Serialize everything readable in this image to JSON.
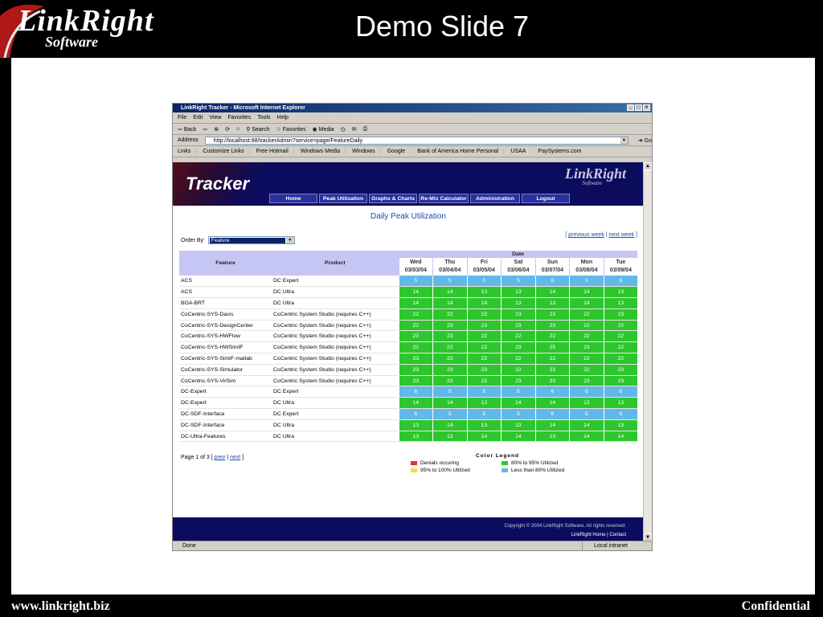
{
  "slide": {
    "logo_line1": "LinkRight",
    "logo_line2": "Software",
    "title": "Demo Slide 7",
    "footer_left": "www.linkright.biz",
    "footer_right": "Confidential"
  },
  "browser": {
    "window_title": "LinkRight Tracker - Microsoft Internet Explorer",
    "menu": [
      "File",
      "Edit",
      "View",
      "Favorites",
      "Tools",
      "Help"
    ],
    "toolbar": [
      "Back",
      "Search",
      "Favorites",
      "Media"
    ],
    "address_label": "Address",
    "address": "http://localhost:88/trackerAdmin?service=page/FeatureDaily",
    "go_label": "Go",
    "links_label": "Links",
    "links": [
      "Customize Links",
      "Free Hotmail",
      "Windows Media",
      "Windows",
      "Google",
      "Bank of America Home Personal",
      "USAA",
      "PaySystems.com"
    ],
    "status": "Done",
    "zone": "Local intranet"
  },
  "app": {
    "banner_title": "Tracker",
    "banner_logo": "LinkRight",
    "banner_logo_sub": "Software",
    "nav": [
      {
        "label": "Home"
      },
      {
        "label": "Peak Utilization"
      },
      {
        "label": "Graphs & Charts"
      },
      {
        "label": "Re-Mix Calculator"
      },
      {
        "label": "Administration"
      },
      {
        "label": "Logout"
      }
    ],
    "page_title": "Daily Peak Utilization",
    "order_by_label": "Order By:",
    "order_by_value": "Feature",
    "week_prev": "previous week",
    "week_next": "next week",
    "col_feature": "Feature",
    "col_product": "Product",
    "col_date": "Date",
    "days": [
      {
        "d": "Wed",
        "date": "03/03/04"
      },
      {
        "d": "Thu",
        "date": "03/04/04"
      },
      {
        "d": "Fri",
        "date": "03/05/04"
      },
      {
        "d": "Sat",
        "date": "03/06/04"
      },
      {
        "d": "Sun",
        "date": "03/07/04"
      },
      {
        "d": "Mon",
        "date": "03/08/04"
      },
      {
        "d": "Tue",
        "date": "03/09/04"
      }
    ],
    "rows": [
      {
        "feature": "ACS",
        "product": "DC Expert",
        "values": [
          5,
          5,
          5,
          5,
          6,
          5,
          6
        ],
        "status": "less-than-80"
      },
      {
        "feature": "ACS",
        "product": "DC Ultra",
        "values": [
          14,
          14,
          13,
          13,
          14,
          14,
          13
        ],
        "status": "80-to-95"
      },
      {
        "feature": "BOA-BRT",
        "product": "DC Ultra",
        "values": [
          14,
          14,
          14,
          13,
          13,
          14,
          13
        ],
        "status": "80-to-95"
      },
      {
        "feature": "CoCentric-SYS-Davis",
        "product": "CoCentric System Studio (requires C++)",
        "values": [
          22,
          22,
          22,
          23,
          23,
          22,
          23
        ],
        "status": "80-to-95"
      },
      {
        "feature": "CoCentric-SYS-DesignCenter",
        "product": "CoCentric System Studio (requires C++)",
        "values": [
          22,
          23,
          23,
          23,
          23,
          22,
          22
        ],
        "status": "80-to-95"
      },
      {
        "feature": "CoCentric-SYS-HWFlow",
        "product": "CoCentric System Studio (requires C++)",
        "values": [
          23,
          23,
          22,
          22,
          22,
          22,
          22
        ],
        "status": "80-to-95"
      },
      {
        "feature": "CoCentric-SYS-HWSimIF",
        "product": "CoCentric System Studio (requires C++)",
        "values": [
          22,
          22,
          22,
          23,
          25,
          23,
          22
        ],
        "status": "80-to-95"
      },
      {
        "feature": "CoCentric-SYS-SimIF-matlab",
        "product": "CoCentric System Studio (requires C++)",
        "values": [
          23,
          22,
          22,
          22,
          22,
          22,
          22
        ],
        "status": "80-to-95"
      },
      {
        "feature": "CoCentric-SYS-Simulator",
        "product": "CoCentric System Studio (requires C++)",
        "values": [
          23,
          23,
          23,
          22,
          23,
          22,
          23
        ],
        "status": "80-to-95"
      },
      {
        "feature": "CoCentric-SYS-VirSim",
        "product": "CoCentric System Studio (requires C++)",
        "values": [
          23,
          23,
          22,
          23,
          23,
          23,
          23
        ],
        "status": "80-to-95"
      },
      {
        "feature": "DC-Expert",
        "product": "DC Expert",
        "values": [
          6,
          5,
          5,
          5,
          6,
          6,
          6
        ],
        "status": "less-than-80"
      },
      {
        "feature": "DC-Expert",
        "product": "DC Ultra",
        "values": [
          14,
          14,
          13,
          14,
          14,
          13,
          13
        ],
        "status": "80-to-95"
      },
      {
        "feature": "DC-SDF-Interface",
        "product": "DC Expert",
        "values": [
          6,
          5,
          5,
          5,
          6,
          5,
          6
        ],
        "status": "less-than-80"
      },
      {
        "feature": "DC-SDF-Interface",
        "product": "DC Ultra",
        "values": [
          13,
          14,
          13,
          13,
          14,
          14,
          13
        ],
        "status": "80-to-95"
      },
      {
        "feature": "DC-Ultra-Features",
        "product": "DC Ultra",
        "values": [
          13,
          13,
          14,
          14,
          13,
          14,
          14
        ],
        "status": "80-to-95"
      }
    ],
    "pager_text": "Page 1 of 3 [",
    "pager_prev": "prev",
    "pager_next": "next",
    "legend_title": "Color Legend",
    "legend": [
      {
        "label": "Denials occuring",
        "color": "#e03030"
      },
      {
        "label": "80% to 95% Utilized",
        "color": "#2dc62d"
      },
      {
        "label": "95% to 100% Utilized",
        "color": "#f0e040"
      },
      {
        "label": "Less than 80% Utilized",
        "color": "#62b8e8"
      }
    ],
    "copyright": "Copyright © 2004 LinkRight Software. All rights reserved.",
    "footer_home": "LinkRight Home",
    "footer_contact": "Contact"
  }
}
